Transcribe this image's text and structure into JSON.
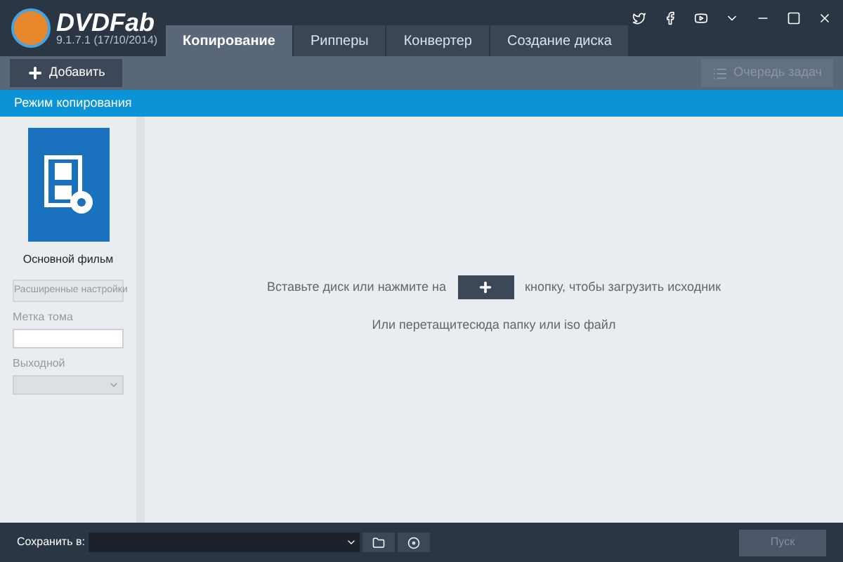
{
  "app": {
    "name": "DVDFab",
    "version": "9.1.7.1 (17/10/2014)"
  },
  "tabs": [
    {
      "label": "Копирование",
      "selected": true
    },
    {
      "label": "Рипперы",
      "selected": false
    },
    {
      "label": "Конвертер",
      "selected": false
    },
    {
      "label": "Создание диска",
      "selected": false
    }
  ],
  "toolbar": {
    "add": "Добавить",
    "queue": "Очередь задач",
    "queue_disabled": true
  },
  "mode_bar": "Режим копирования",
  "sidebar": {
    "mode_label": "Основной фильм",
    "advanced": "Расширенные настройки",
    "volume_label": "Метка тома",
    "output_label": "Выходной"
  },
  "main": {
    "hint_before": "Вставьте диск или нажмите на",
    "hint_after": "кнопку, чтобы загрузить исходник",
    "hint2": "Или перетащитесюда папку или iso файл"
  },
  "bottom": {
    "save_label": "Сохранить в:",
    "start": "Пуск",
    "start_disabled": true
  }
}
